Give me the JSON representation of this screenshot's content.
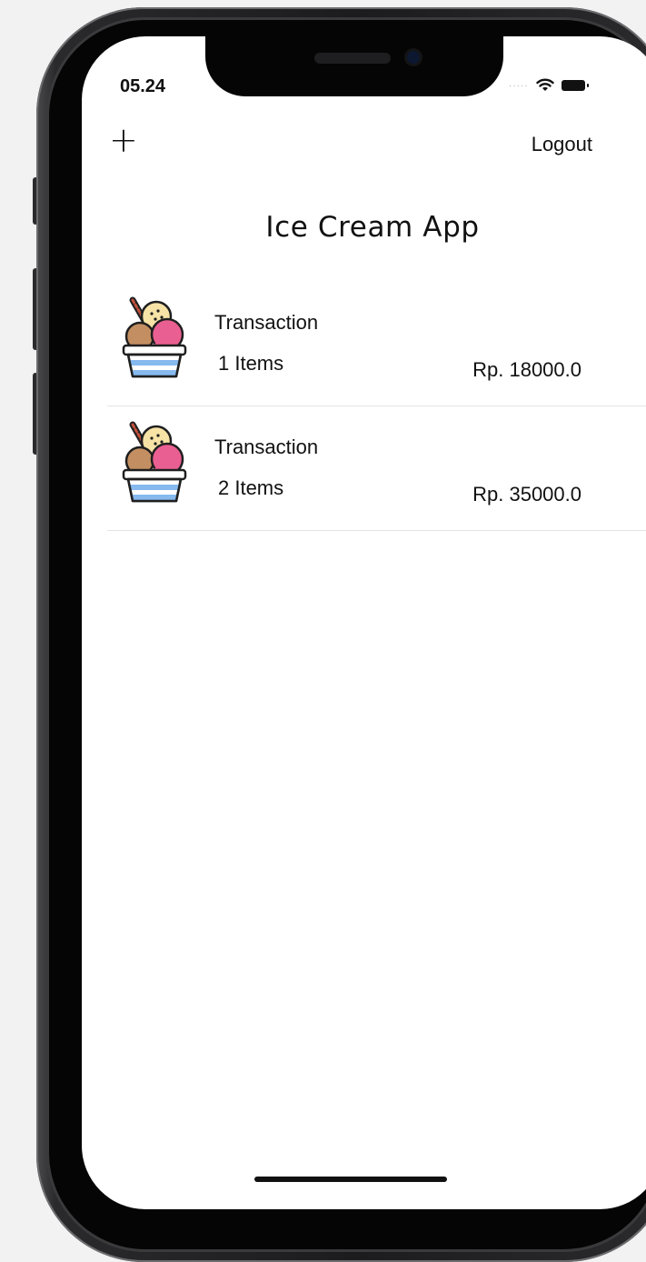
{
  "status_bar": {
    "time": "05.24",
    "signal": "·····"
  },
  "nav": {
    "add_label": "+",
    "logout_label": "Logout"
  },
  "page": {
    "title": "Ice Cream App"
  },
  "transactions": [
    {
      "title": "Transaction",
      "count": "1  Items",
      "price": "Rp. 18000.0",
      "icon": "ice-cream-cup-icon"
    },
    {
      "title": "Transaction",
      "count": "2  Items",
      "price": "Rp. 35000.0",
      "icon": "ice-cream-cup-icon"
    }
  ],
  "colors": {
    "scoop_vanilla": "#f7e3a6",
    "scoop_chocolate": "#c38f62",
    "scoop_strawberry": "#ea5f91",
    "cup_blue": "#86b9ee",
    "outline": "#1f1f1f"
  }
}
